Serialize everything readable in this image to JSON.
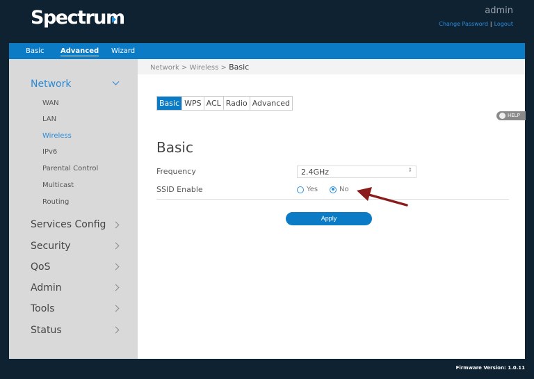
{
  "header": {
    "logo": "Spectrum",
    "user": "admin",
    "change_password": "Change Password",
    "separator": "|",
    "logout": "Logout"
  },
  "nav": {
    "items": [
      {
        "label": "Basic"
      },
      {
        "label": "Advanced",
        "active": true
      },
      {
        "label": "Wizard"
      }
    ]
  },
  "sidebar": {
    "network": "Network",
    "sub_items": [
      "WAN",
      "LAN",
      "Wireless",
      "IPv6",
      "Parental Control",
      "Multicast",
      "Routing"
    ],
    "active_sub": "Wireless",
    "sections": [
      "Services Config",
      "Security",
      "QoS",
      "Admin",
      "Tools",
      "Status"
    ]
  },
  "breadcrumb": {
    "path": "Network > Wireless > ",
    "current": "Basic"
  },
  "tabs": [
    "Basic",
    "WPS",
    "ACL",
    "Radio",
    "Advanced"
  ],
  "active_tab": "Basic",
  "help": "HELP",
  "form": {
    "title": "Basic",
    "frequency_label": "Frequency",
    "frequency_value": "2.4GHz",
    "ssid_label": "SSID Enable",
    "yes": "Yes",
    "no": "No",
    "ssid_selected": "No",
    "apply": "Apply"
  },
  "footer": {
    "firmware": "Firmware Version: 1.0.11"
  },
  "colors": {
    "accent": "#0b7bc6",
    "background": "#0f2232",
    "annotation_arrow": "#8b1a1a"
  }
}
